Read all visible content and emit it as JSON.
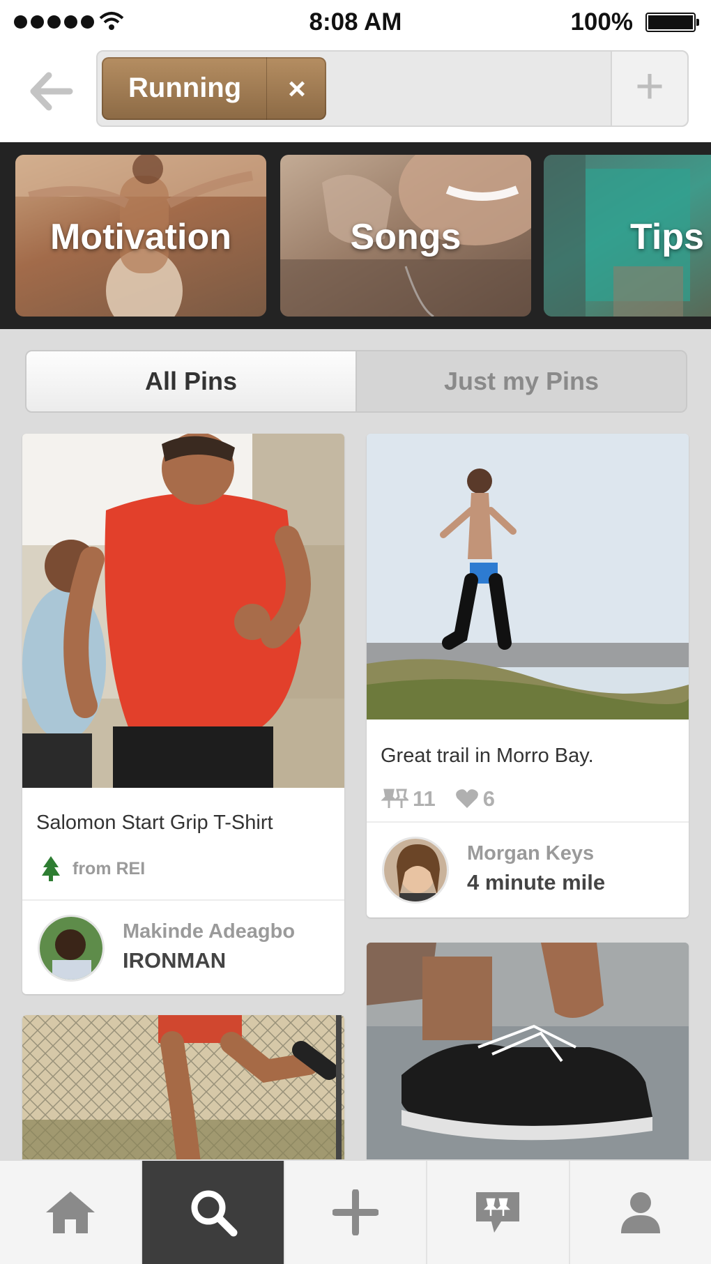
{
  "status_bar": {
    "time": "8:08 AM",
    "battery": "100%"
  },
  "search": {
    "chip_label": "Running",
    "chip_remove": "×",
    "add_label": "+"
  },
  "categories": [
    {
      "label": "Motivation"
    },
    {
      "label": "Songs"
    },
    {
      "label": "Tips"
    }
  ],
  "segment": {
    "all": "All Pins",
    "mine": "Just my Pins"
  },
  "pins": {
    "left_1": {
      "description": "Salomon Start Grip T-Shirt",
      "source": "from REI",
      "user": "Makinde Adeagbo",
      "board": "IRONMAN"
    },
    "right_1": {
      "description": "Great trail in Morro Bay.",
      "repins": "11",
      "likes": "6",
      "user": "Morgan Keys",
      "board": "4 minute mile"
    }
  },
  "tabs": [
    "home-icon",
    "search-icon",
    "add-icon",
    "news-icon",
    "profile-icon"
  ],
  "colors": {
    "chip": "#9e7a52",
    "active_tab": "#3d3d3d",
    "strip": "#232323"
  }
}
